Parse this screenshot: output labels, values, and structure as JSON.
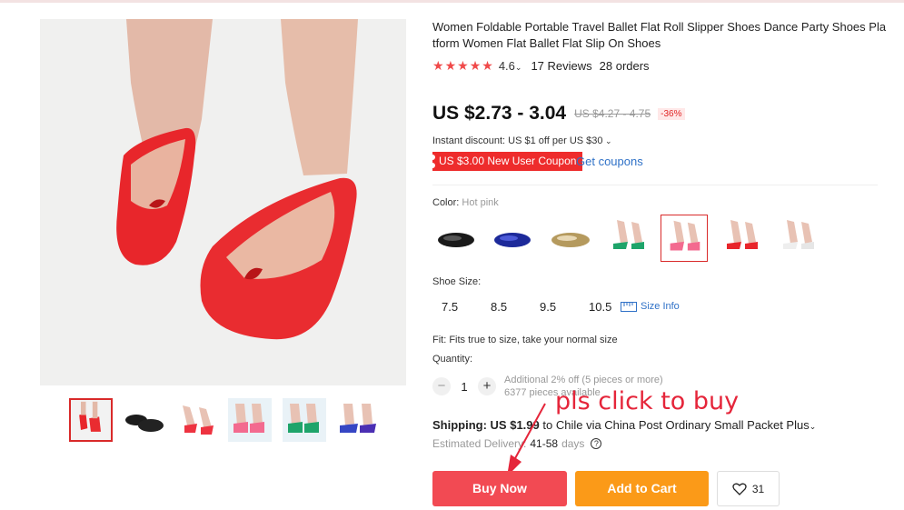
{
  "product": {
    "title": "Women Foldable Portable Travel Ballet Flat Roll Slipper Shoes Dance Party Shoes Platform Women Flat Ballet Flat Slip On Shoes",
    "rating": "4.6",
    "rating_stars": 4.6,
    "reviews": "17 Reviews",
    "orders": "28 orders",
    "price": "US $2.73 - 3.04",
    "original_price": "US $4.27 - 4.75",
    "discount": "-36%",
    "instant_discount": "Instant discount: US $1 off per US $30",
    "coupon": "US $3.00 New User Coupon",
    "get_coupons": "Get coupons"
  },
  "options": {
    "color_label": "Color:",
    "color_value": "Hot pink",
    "swatches": [
      "black",
      "blue",
      "gold",
      "green",
      "hot pink",
      "red",
      "white"
    ],
    "selected_swatch": 4,
    "size_label": "Shoe Size:",
    "sizes": [
      "7.5",
      "8.5",
      "9.5",
      "10.5"
    ],
    "size_info": "Size Info",
    "fit": "Fit: Fits true to size, take your normal size",
    "quantity_label": "Quantity:",
    "quantity": "1",
    "quantity_minus": "−",
    "quantity_plus": "+",
    "quantity_note_1": "Additional 2% off (5 pieces or more)",
    "quantity_note_2": "6377 pieces available"
  },
  "shipping": {
    "label": "Shipping: US $1.99",
    "text": "to Chile via China Post Ordinary Small Packet Plus",
    "delivery_label": "Estimated Delivery:",
    "delivery_days": "41-58",
    "delivery_unit": "days"
  },
  "actions": {
    "buy_now": "Buy Now",
    "add_to_cart": "Add to Cart",
    "wishlist_count": "31"
  },
  "annotation": "pls click to buy",
  "colors": {
    "accent_red": "#f24a53",
    "cart_orange": "#fb9a18",
    "link_blue": "#2f71c7",
    "annotation_red": "#e5253a"
  }
}
